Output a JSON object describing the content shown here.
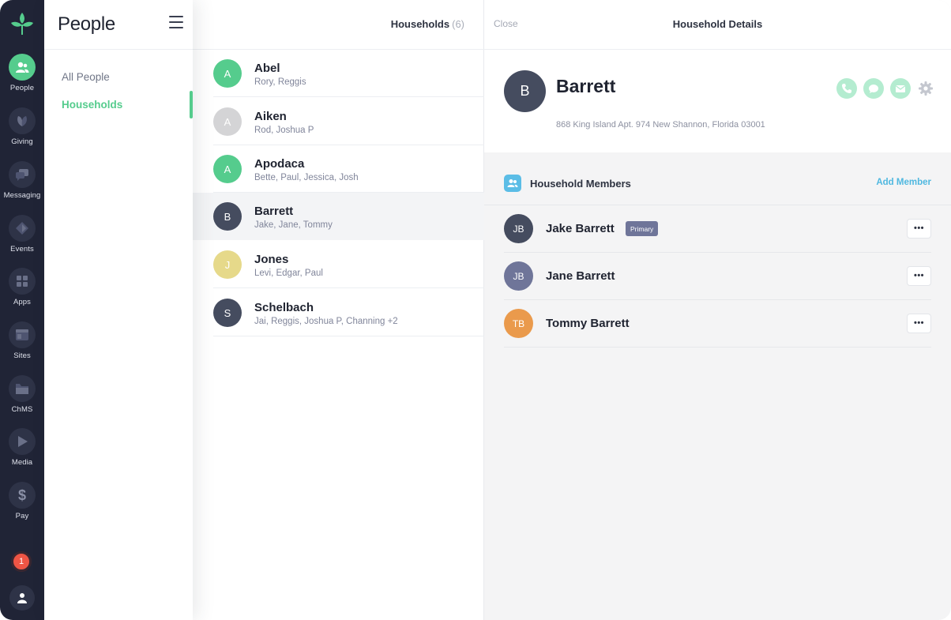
{
  "rail": {
    "items": [
      {
        "label": "People",
        "icon": "people-icon",
        "active": true
      },
      {
        "label": "Giving",
        "icon": "leaf-icon"
      },
      {
        "label": "Messaging",
        "icon": "chat-icon"
      },
      {
        "label": "Events",
        "icon": "events-icon"
      },
      {
        "label": "Apps",
        "icon": "apps-grid-icon"
      },
      {
        "label": "Sites",
        "icon": "sites-icon"
      },
      {
        "label": "ChMS",
        "icon": "folder-icon"
      },
      {
        "label": "Media",
        "icon": "play-icon"
      },
      {
        "label": "Pay",
        "icon": "dollar-icon"
      }
    ],
    "notification_count": "1"
  },
  "secnav": {
    "title": "People",
    "links": [
      {
        "label": "All People",
        "active": false
      },
      {
        "label": "Households",
        "active": true
      }
    ]
  },
  "list": {
    "title": "Households",
    "count": "(6)",
    "households": [
      {
        "initial": "A",
        "name": "Abel",
        "members": "Rory, Reggis",
        "color": "#55cc8d"
      },
      {
        "initial": "A",
        "name": "Aiken",
        "members": "Rod, Joshua P",
        "color": "#d4d4d6"
      },
      {
        "initial": "A",
        "name": "Apodaca",
        "members": "Bette, Paul, Jessica, Josh",
        "color": "#55cc8d"
      },
      {
        "initial": "B",
        "name": "Barrett",
        "members": "Jake, Jane, Tommy",
        "color": "#454c5f",
        "selected": true
      },
      {
        "initial": "J",
        "name": "Jones",
        "members": "Levi, Edgar, Paul",
        "color": "#e6d98a"
      },
      {
        "initial": "S",
        "name": "Schelbach",
        "members": "Jai, Reggis, Joshua P, Channing +2",
        "color": "#454c5f"
      }
    ]
  },
  "details": {
    "close_label": "Close",
    "title": "Household Details",
    "household": {
      "initial": "B",
      "name": "Barrett",
      "address": "868 King Island Apt. 974 New Shannon, Florida 03001"
    },
    "members_title": "Household Members",
    "add_member_label": "Add Member",
    "primary_label": "Primary",
    "more_label": "•••",
    "members": [
      {
        "initials": "JB",
        "name": "Jake Barrett",
        "primary": true,
        "color": "#454c5f"
      },
      {
        "initials": "JB",
        "name": "Jane Barrett",
        "primary": false,
        "color": "#6f7599"
      },
      {
        "initials": "TB",
        "name": "Tommy Barrett",
        "primary": false,
        "color": "#ea9a4c"
      }
    ]
  },
  "colors": {
    "accent": "#55cc8d",
    "rail_bg": "#202436",
    "link_blue": "#4fb8e0"
  }
}
